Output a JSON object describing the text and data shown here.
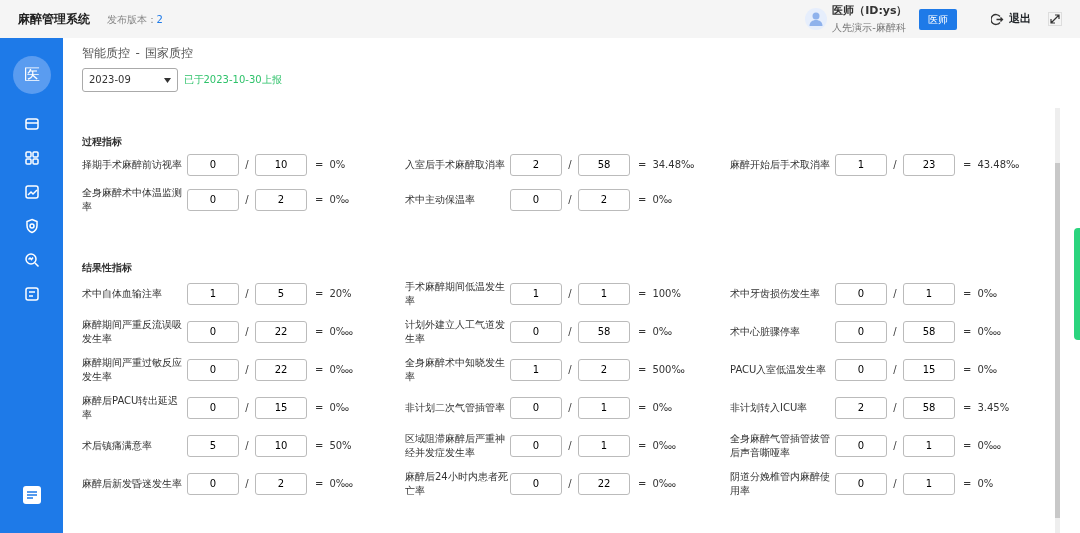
{
  "header": {
    "title": "麻醉管理系统",
    "version_label": "发布版本：",
    "version": "2",
    "user_name": "医师（ID:ys）",
    "user_dept": "人先演示-麻醉科",
    "role_button": "医师",
    "logout": "退出"
  },
  "sidebar": {
    "avatar": "医"
  },
  "breadcrumb": [
    "智能质控",
    "-",
    "国家质控"
  ],
  "month_select": {
    "value": "2023-09"
  },
  "report_status": "已于2023-10-30上报",
  "sections": [
    {
      "title": "过程指标",
      "items": [
        {
          "label": "择期手术麻醉前访视率",
          "numerator": "0",
          "slash": "/",
          "denominator": "10",
          "equals": "=",
          "result": "0%"
        },
        {
          "label": "入室后手术麻醉取消率",
          "numerator": "2",
          "slash": "/",
          "denominator": "58",
          "equals": "=",
          "result": "34.48‰"
        },
        {
          "label": "麻醉开始后手术取消率",
          "numerator": "1",
          "slash": "/",
          "denominator": "23",
          "equals": "=",
          "result": "43.48‰"
        },
        {
          "label": "全身麻醉术中体温监测率",
          "numerator": "0",
          "slash": "/",
          "denominator": "2",
          "equals": "=",
          "result": "0‰"
        },
        {
          "label": "术中主动保温率",
          "numerator": "0",
          "slash": "/",
          "denominator": "2",
          "equals": "=",
          "result": "0‰"
        }
      ]
    },
    {
      "title": "结果性指标",
      "items": [
        {
          "label": "术中自体血输注率",
          "numerator": "1",
          "slash": "/",
          "denominator": "5",
          "equals": "=",
          "result": "20%"
        },
        {
          "label": "手术麻醉期间低温发生率",
          "numerator": "1",
          "slash": "/",
          "denominator": "1",
          "equals": "=",
          "result": "100%"
        },
        {
          "label": "术中牙齿损伤发生率",
          "numerator": "0",
          "slash": "/",
          "denominator": "1",
          "equals": "=",
          "result": "0‰"
        },
        {
          "label": "麻醉期间严重反流误吸发生率",
          "numerator": "0",
          "slash": "/",
          "denominator": "22",
          "equals": "=",
          "result": "0‱"
        },
        {
          "label": "计划外建立人工气道发生率",
          "numerator": "0",
          "slash": "/",
          "denominator": "58",
          "equals": "=",
          "result": "0‰"
        },
        {
          "label": "术中心脏骤停率",
          "numerator": "0",
          "slash": "/",
          "denominator": "58",
          "equals": "=",
          "result": "0‱"
        },
        {
          "label": "麻醉期间严重过敏反应发生率",
          "numerator": "0",
          "slash": "/",
          "denominator": "22",
          "equals": "=",
          "result": "0‱"
        },
        {
          "label": "全身麻醉术中知晓发生率",
          "numerator": "1",
          "slash": "/",
          "denominator": "2",
          "equals": "=",
          "result": "500‰"
        },
        {
          "label": "PACU入室低温发生率",
          "numerator": "0",
          "slash": "/",
          "denominator": "15",
          "equals": "=",
          "result": "0‰"
        },
        {
          "label": "麻醉后PACU转出延迟率",
          "numerator": "0",
          "slash": "/",
          "denominator": "15",
          "equals": "=",
          "result": "0‰"
        },
        {
          "label": "非计划二次气管插管率",
          "numerator": "0",
          "slash": "/",
          "denominator": "1",
          "equals": "=",
          "result": "0‰"
        },
        {
          "label": "非计划转入ICU率",
          "numerator": "2",
          "slash": "/",
          "denominator": "58",
          "equals": "=",
          "result": "3.45%"
        },
        {
          "label": "术后镇痛满意率",
          "numerator": "5",
          "slash": "/",
          "denominator": "10",
          "equals": "=",
          "result": "50%"
        },
        {
          "label": "区域阻滞麻醉后严重神经并发症发生率",
          "numerator": "0",
          "slash": "/",
          "denominator": "1",
          "equals": "=",
          "result": "0‱"
        },
        {
          "label": "全身麻醉气管插管拔管后声音嘶哑率",
          "numerator": "0",
          "slash": "/",
          "denominator": "1",
          "equals": "=",
          "result": "0‱"
        },
        {
          "label": "麻醉后新发昏迷发生率",
          "numerator": "0",
          "slash": "/",
          "denominator": "2",
          "equals": "=",
          "result": "0‱"
        },
        {
          "label": "麻醉后24小时内患者死亡率",
          "numerator": "0",
          "slash": "/",
          "denominator": "22",
          "equals": "=",
          "result": "0‱"
        },
        {
          "label": "阴道分娩椎管内麻醉使用率",
          "numerator": "0",
          "slash": "/",
          "denominator": "1",
          "equals": "=",
          "result": "0%"
        }
      ]
    }
  ]
}
